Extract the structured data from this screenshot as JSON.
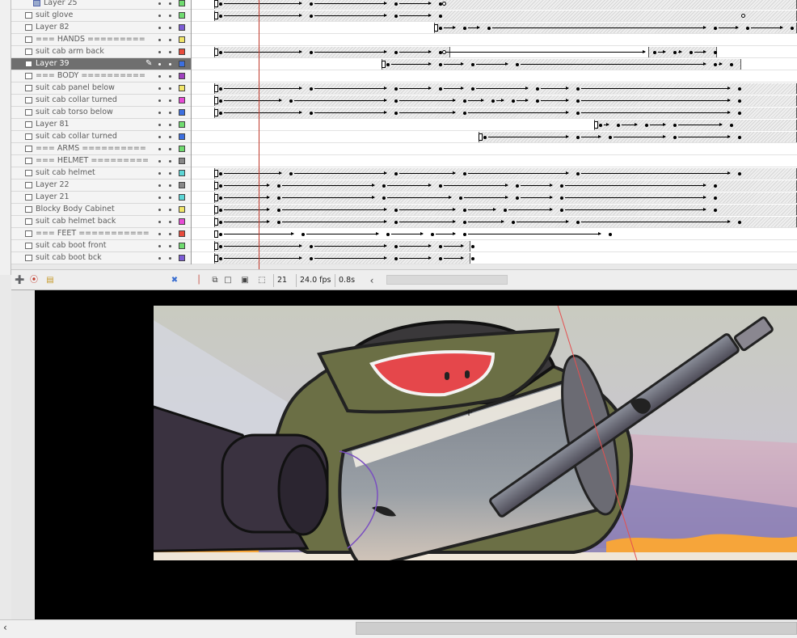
{
  "layers": [
    {
      "name": "Layer 25",
      "color": "#6fdb6f",
      "type": "layer",
      "indent": true
    },
    {
      "name": "suit glove",
      "color": "#6fdb6f",
      "type": "layer"
    },
    {
      "name": "Layer 82",
      "color": "#7c5cd6",
      "type": "layer"
    },
    {
      "name": "=== HANDS =========",
      "color": "#f2e66a",
      "type": "layer"
    },
    {
      "name": "suit cab arm back",
      "color": "#e84b3c",
      "type": "layer"
    },
    {
      "name": "Layer 39",
      "color": "#3c6fe0",
      "type": "layer",
      "selected": true
    },
    {
      "name": "=== BODY ==========",
      "color": "#a040c0",
      "type": "layer"
    },
    {
      "name": "suit cab panel below",
      "color": "#f2e66a",
      "type": "layer"
    },
    {
      "name": "suit cab collar turned",
      "color": "#e84bd6",
      "type": "layer"
    },
    {
      "name": "suit cab torso below",
      "color": "#3c6fe0",
      "type": "layer"
    },
    {
      "name": "Layer 81",
      "color": "#6fdb6f",
      "type": "layer"
    },
    {
      "name": "suit cab collar turned",
      "color": "#3c6fe0",
      "type": "layer"
    },
    {
      "name": "=== ARMS ==========",
      "color": "#6fdb6f",
      "type": "layer"
    },
    {
      "name": "=== HELMET =========",
      "color": "#888888",
      "type": "layer"
    },
    {
      "name": "suit cab helmet",
      "color": "#5cd6d6",
      "type": "layer"
    },
    {
      "name": "Layer 22",
      "color": "#888888",
      "type": "layer"
    },
    {
      "name": "Layer 21",
      "color": "#5cd6d6",
      "type": "layer"
    },
    {
      "name": "Blocky Body Cabinet",
      "color": "#f2e66a",
      "type": "layer"
    },
    {
      "name": "suit cab helmet back",
      "color": "#e84bd6",
      "type": "layer"
    },
    {
      "name": "=== FEET ===========",
      "color": "#e84b3c",
      "type": "layer"
    },
    {
      "name": "suit cab boot front",
      "color": "#6fdb6f",
      "type": "layer"
    },
    {
      "name": "suit cab boot bck",
      "color": "#7c5cd6",
      "type": "layer"
    }
  ],
  "status": {
    "current_frame": "21",
    "fps": "24.0 fps",
    "elapsed": "0.8s"
  },
  "icons": {
    "new_layer": "new-layer-icon",
    "motion_guide": "add-motion-guide-icon",
    "new_folder": "new-folder-icon",
    "delete": "trash-icon",
    "scroll_left": "chevron-left-icon"
  },
  "colors": {
    "accent_playhead": "#c0392b",
    "selected_row": "#6f6f6f",
    "stage_sky": "#c7cabe",
    "character_body": "#6b6f45",
    "visor": "#e5474b"
  }
}
